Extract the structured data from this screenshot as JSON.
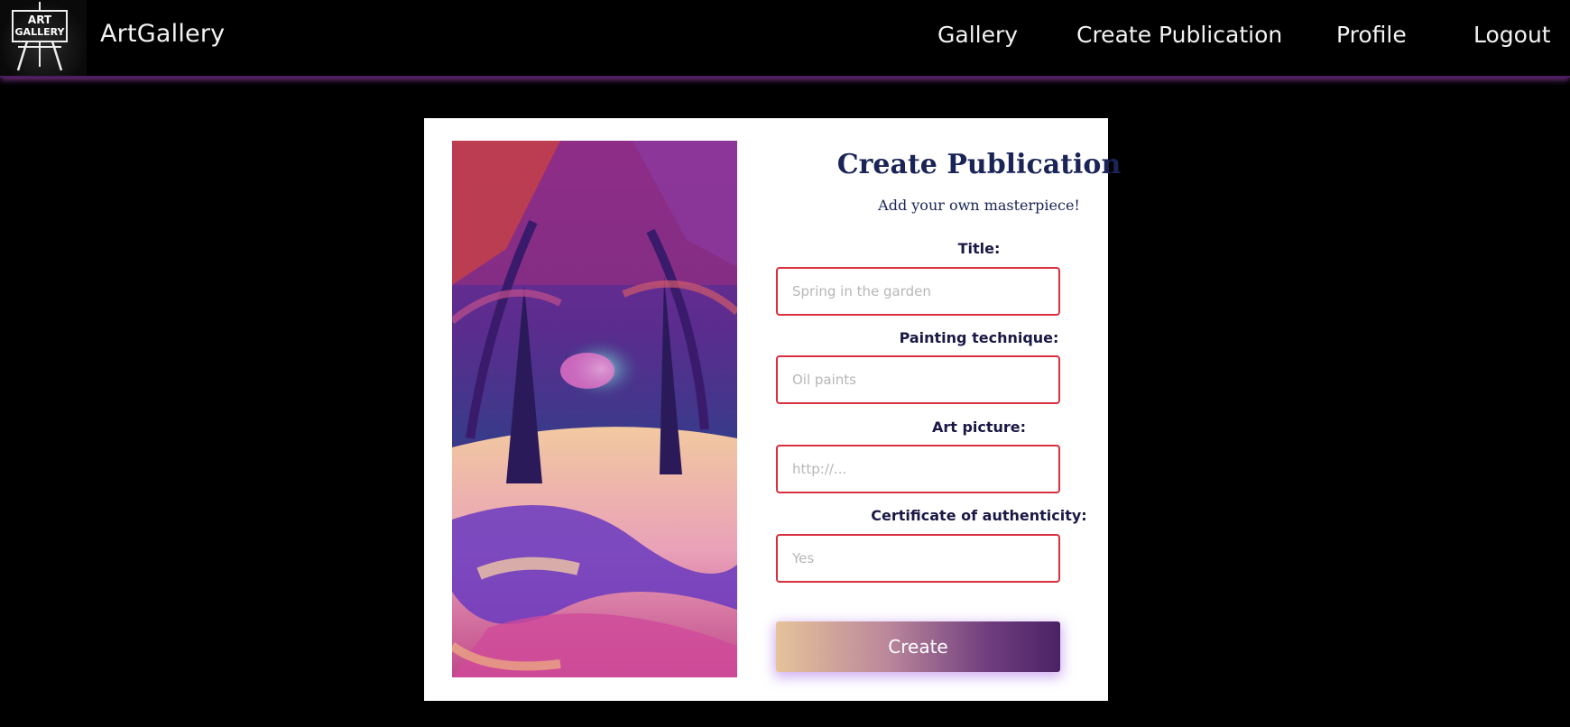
{
  "nav": {
    "logo_text_line1": "ART",
    "logo_text_line2": "GALLERY",
    "brand": "ArtGallery",
    "links": [
      "Gallery",
      "Create Publication",
      "Profile",
      "Logout"
    ]
  },
  "form": {
    "title": "Create Publication",
    "subtitle": "Add your own masterpiece!",
    "fields": [
      {
        "label": "Title:",
        "placeholder": "Spring in the garden"
      },
      {
        "label": "Painting technique:",
        "placeholder": "Oil paints"
      },
      {
        "label": "Art picture:",
        "placeholder": "http://..."
      },
      {
        "label": "Certificate of authenticity:",
        "placeholder": "Yes"
      }
    ],
    "submit_label": "Create"
  },
  "colors": {
    "nav_bg": "#000000",
    "accent_purple": "#6a2d7a",
    "title_navy": "#1a2456",
    "input_border": "#d9303f",
    "button_gradient_start": "#e6c39a",
    "button_gradient_end": "#4a2266"
  }
}
